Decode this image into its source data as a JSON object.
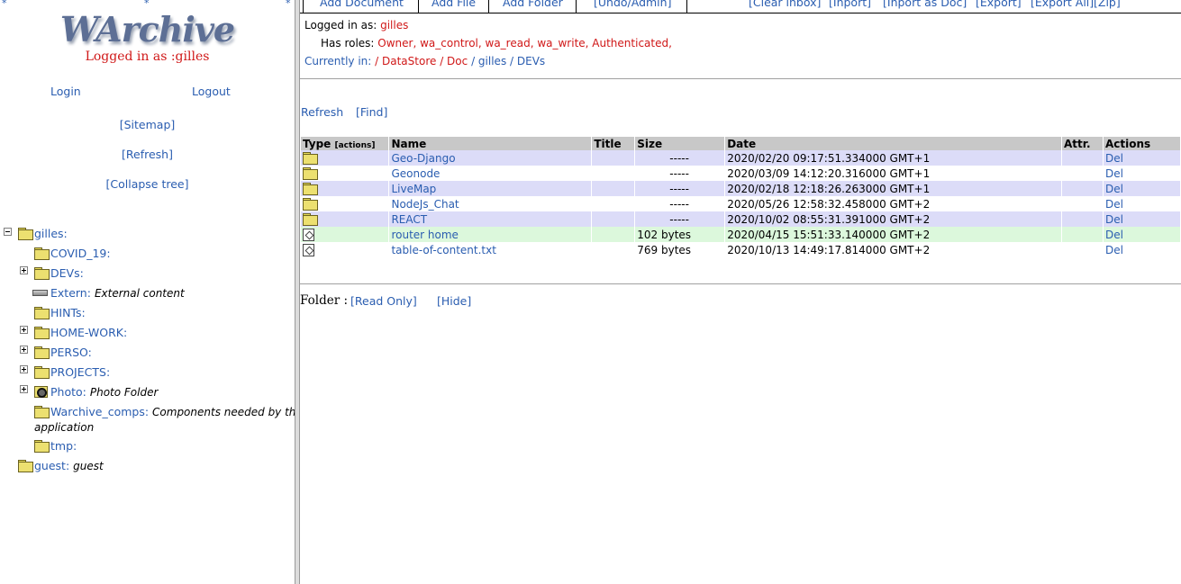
{
  "left": {
    "stars": [
      "*",
      "*",
      "*"
    ],
    "logo": "WArchive",
    "logged_in": "Logged in as :gilles",
    "login": "Login",
    "logout": "Logout",
    "sitemap": "[Sitemap]",
    "refresh": "[Refresh]",
    "collapse": "[Collapse tree]",
    "tree": [
      {
        "name": "gilles:",
        "desc": ""
      },
      {
        "name": "COVID_19:",
        "desc": ""
      },
      {
        "name": "DEVs:",
        "desc": ""
      },
      {
        "name": "Extern:",
        "desc": "External content"
      },
      {
        "name": "HINTs:",
        "desc": ""
      },
      {
        "name": "HOME-WORK:",
        "desc": ""
      },
      {
        "name": "PERSO:",
        "desc": ""
      },
      {
        "name": "PROJECTS:",
        "desc": ""
      },
      {
        "name": "Photo:",
        "desc": "Photo Folder"
      },
      {
        "name": "Warchive_comps:",
        "desc": "Components needed by this",
        "desc2": "application"
      },
      {
        "name": "tmp:",
        "desc": ""
      },
      {
        "name": "guest:",
        "desc": "guest"
      }
    ]
  },
  "toolbar": {
    "add_document": "Add Document",
    "add_file": "Add File",
    "add_folder": "Add Folder",
    "undo_admin": "[Undo/Admin]",
    "clear_inbox": "[Clear inbox]",
    "inport": "[Inport]",
    "inport_doc": "[Inport as Doc]",
    "export": "[Export]",
    "export_all": "[Export All]",
    "zip": "[Zip]"
  },
  "info": {
    "logged_label": "Logged in as:",
    "user": "gilles",
    "roles_label": "Has roles:",
    "roles": "Owner, wa_control, wa_read, wa_write, Authenticated,",
    "current_label": "Currently in:",
    "path": [
      "/ DataStore",
      "/ Doc",
      "/ gilles",
      "/ DEVs"
    ]
  },
  "actions": {
    "refresh": "Refresh",
    "find": "[Find]"
  },
  "table": {
    "headers": {
      "type": "Type",
      "type_small": "[actions]",
      "name": "Name",
      "title": "Title",
      "size": "Size",
      "date": "Date",
      "attr": "Attr.",
      "actions": "Actions"
    },
    "rows": [
      {
        "name": "Geo-Django",
        "title": "",
        "size": "-----",
        "date": "2020/02/20 09:17:51.334000 GMT+1",
        "attr": "",
        "action": "Del"
      },
      {
        "name": "Geonode",
        "title": "",
        "size": "-----",
        "date": "2020/03/09 14:12:20.316000 GMT+1",
        "attr": "",
        "action": "Del"
      },
      {
        "name": "LiveMap",
        "title": "",
        "size": "-----",
        "date": "2020/02/18 12:18:26.263000 GMT+1",
        "attr": "",
        "action": "Del"
      },
      {
        "name": "NodeJs_Chat",
        "title": "",
        "size": "-----",
        "date": "2020/05/26 12:58:32.458000 GMT+2",
        "attr": "",
        "action": "Del"
      },
      {
        "name": "REACT",
        "title": "",
        "size": "-----",
        "date": "2020/10/02 08:55:31.391000 GMT+2",
        "attr": "",
        "action": "Del"
      },
      {
        "name": "router home",
        "title": "",
        "size": "102 bytes",
        "date": "2020/04/15 15:51:33.140000 GMT+2",
        "attr": "",
        "action": "Del"
      },
      {
        "name": "table-of-content.txt",
        "title": "",
        "size": "769 bytes",
        "date": "2020/10/13 14:49:17.814000 GMT+2",
        "attr": "",
        "action": "Del"
      }
    ]
  },
  "folder_bar": {
    "label": "Folder :",
    "read_only": "[Read Only]",
    "hide": "[Hide]"
  }
}
